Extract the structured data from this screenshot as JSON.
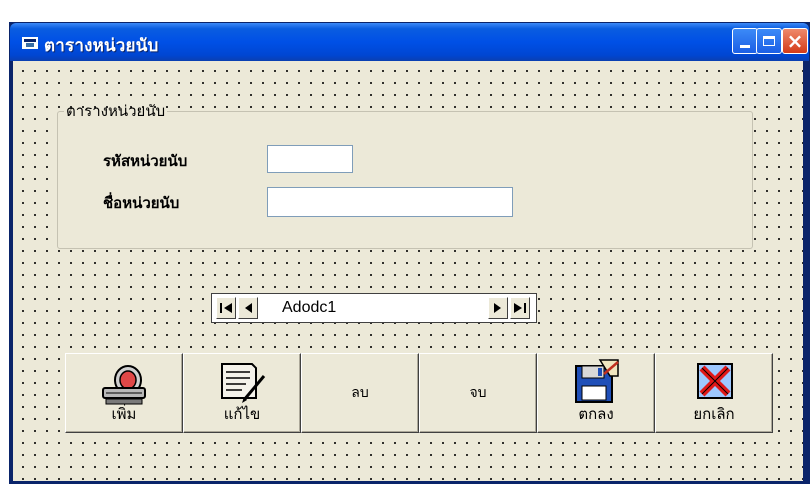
{
  "window": {
    "title": "ตารางหน่วยนับ"
  },
  "frame": {
    "caption": "ตารางหน่วยนับ",
    "fields": [
      {
        "label": "รหัสหน่วยนับ",
        "value": ""
      },
      {
        "label": "ชื่อหน่วยนับ",
        "value": ""
      }
    ]
  },
  "adodc": {
    "caption": "Adodc1"
  },
  "buttons": [
    {
      "label": "เพิ่ม",
      "icon": "computer-icon"
    },
    {
      "label": "แก้ไข",
      "icon": "edit-document-icon"
    },
    {
      "label": "ลบ",
      "icon": ""
    },
    {
      "label": "จบ",
      "icon": ""
    },
    {
      "label": "ตกลง",
      "icon": "save-disk-icon"
    },
    {
      "label": "ยกเลิก",
      "icon": "cancel-x-icon"
    }
  ]
}
